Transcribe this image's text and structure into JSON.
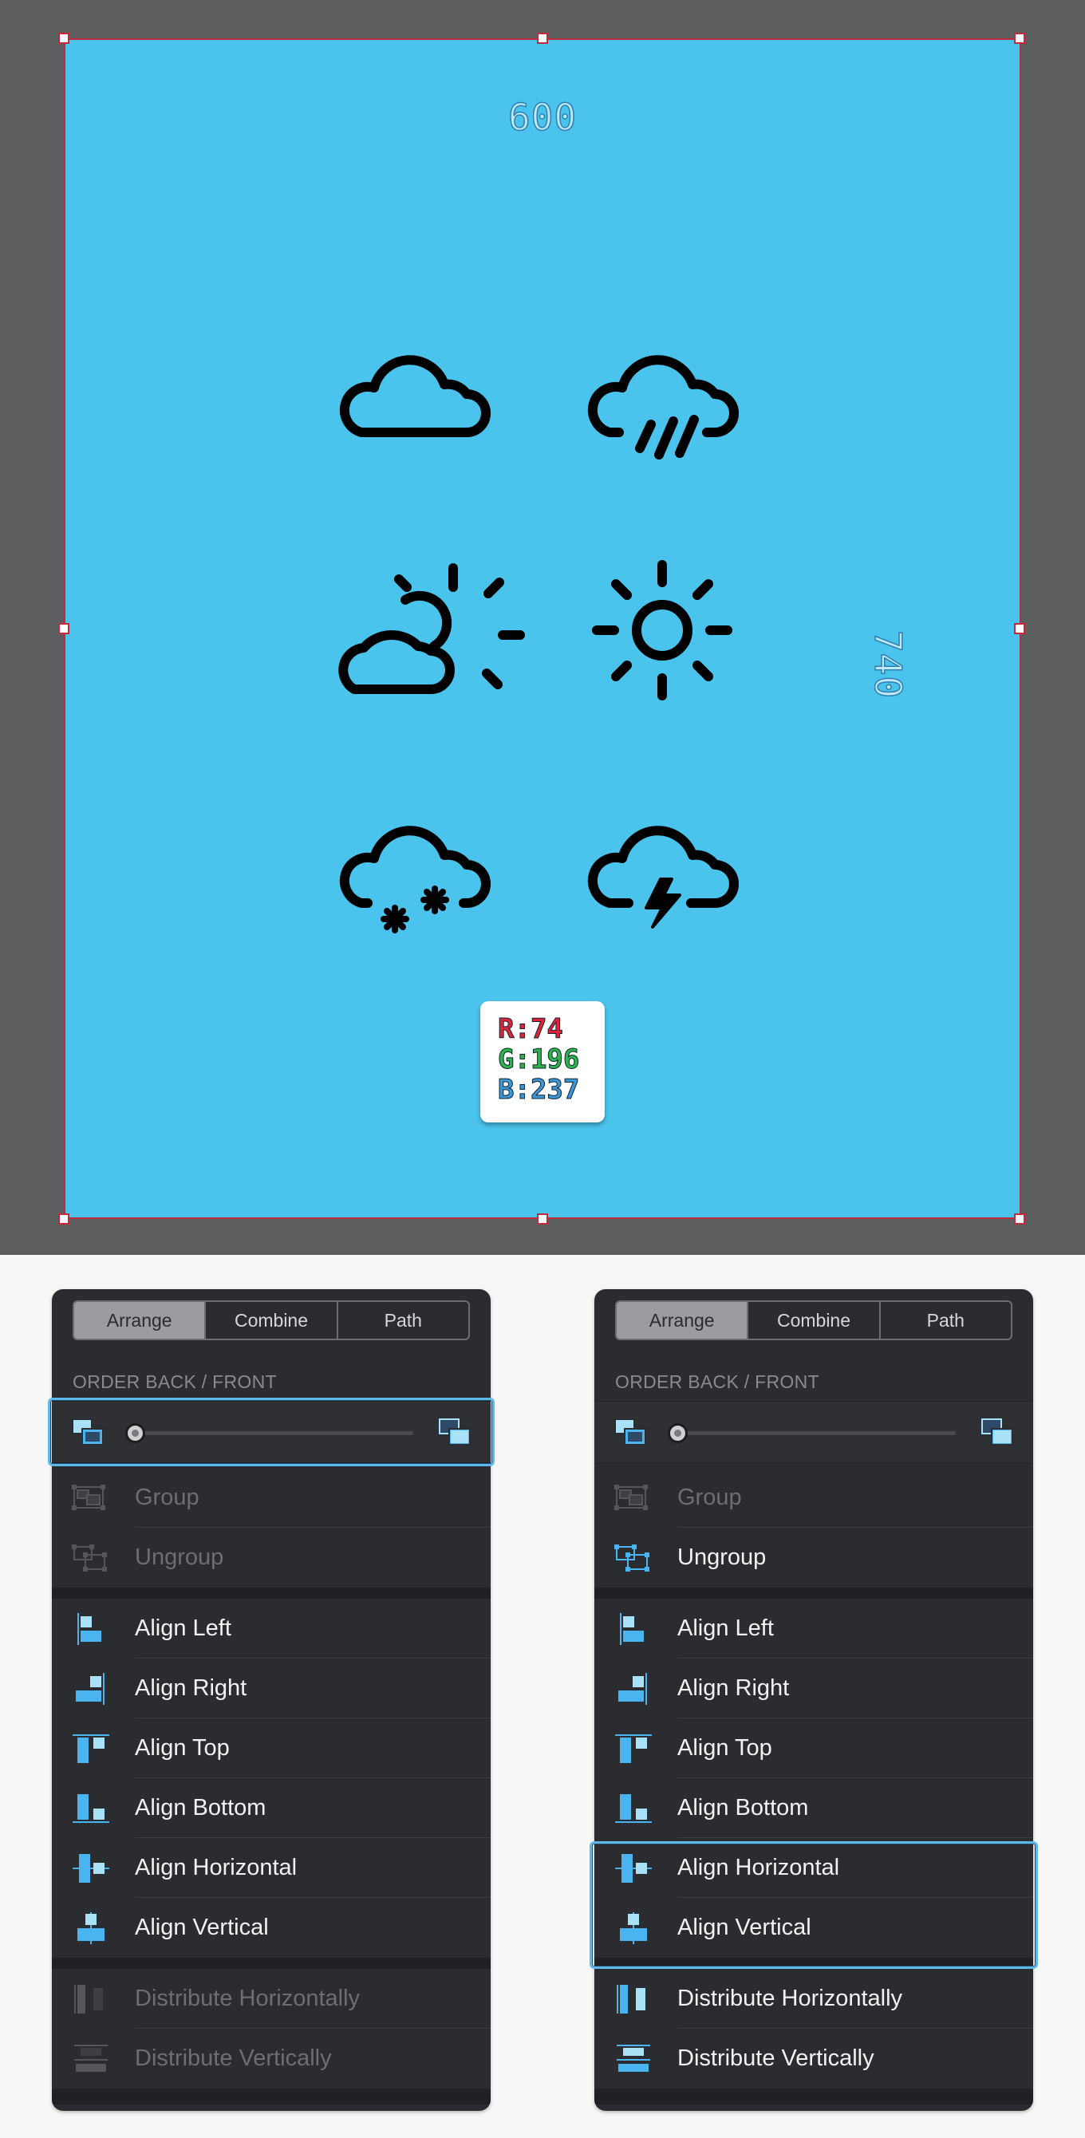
{
  "canvas": {
    "width_label": "600",
    "height_label": "740",
    "artboard_color": "#4ac4ed",
    "icons": [
      "cloud-icon",
      "rain-cloud-icon",
      "partly-sunny-icon",
      "sun-icon",
      "snow-cloud-icon",
      "thunder-cloud-icon"
    ],
    "color_chip": {
      "r": "R:74",
      "g": "G:196",
      "b": "B:237"
    }
  },
  "panel_left": {
    "tabs": [
      {
        "label": "Arrange",
        "active": true
      },
      {
        "label": "Combine",
        "active": false
      },
      {
        "label": "Path",
        "active": false
      }
    ],
    "section_label": "ORDER BACK / FRONT",
    "items": [
      {
        "label": "Group",
        "icon": "group-icon",
        "disabled": true
      },
      {
        "label": "Ungroup",
        "icon": "ungroup-icon",
        "disabled": true
      },
      {
        "label": "Align Left",
        "icon": "align-left-icon",
        "disabled": false
      },
      {
        "label": "Align Right",
        "icon": "align-right-icon",
        "disabled": false
      },
      {
        "label": "Align Top",
        "icon": "align-top-icon",
        "disabled": false
      },
      {
        "label": "Align Bottom",
        "icon": "align-bottom-icon",
        "disabled": false
      },
      {
        "label": "Align Horizontal",
        "icon": "align-horizontal-icon",
        "disabled": false
      },
      {
        "label": "Align Vertical",
        "icon": "align-vertical-icon",
        "disabled": false
      },
      {
        "label": "Distribute Horizontally",
        "icon": "distribute-horizontally-icon",
        "disabled": true
      },
      {
        "label": "Distribute Vertically",
        "icon": "distribute-vertically-icon",
        "disabled": true
      }
    ]
  },
  "panel_right": {
    "tabs": [
      {
        "label": "Arrange",
        "active": true
      },
      {
        "label": "Combine",
        "active": false
      },
      {
        "label": "Path",
        "active": false
      }
    ],
    "section_label": "ORDER BACK / FRONT",
    "items": [
      {
        "label": "Group",
        "icon": "group-icon",
        "disabled": true
      },
      {
        "label": "Ungroup",
        "icon": "ungroup-icon",
        "disabled": false
      },
      {
        "label": "Align Left",
        "icon": "align-left-icon",
        "disabled": false
      },
      {
        "label": "Align Right",
        "icon": "align-right-icon",
        "disabled": false
      },
      {
        "label": "Align Top",
        "icon": "align-top-icon",
        "disabled": false
      },
      {
        "label": "Align Bottom",
        "icon": "align-bottom-icon",
        "disabled": false
      },
      {
        "label": "Align Horizontal",
        "icon": "align-horizontal-icon",
        "disabled": false
      },
      {
        "label": "Align Vertical",
        "icon": "align-vertical-icon",
        "disabled": false
      },
      {
        "label": "Distribute Horizontally",
        "icon": "distribute-horizontally-icon",
        "disabled": false
      },
      {
        "label": "Distribute Vertically",
        "icon": "distribute-vertically-icon",
        "disabled": false
      }
    ]
  },
  "colors": {
    "accent": "#4ab4f0",
    "accent_light": "#a9e2f7",
    "panel_bg": "#2b2c30",
    "highlight": "#5fb8ec",
    "selection": "#c12b3b"
  }
}
